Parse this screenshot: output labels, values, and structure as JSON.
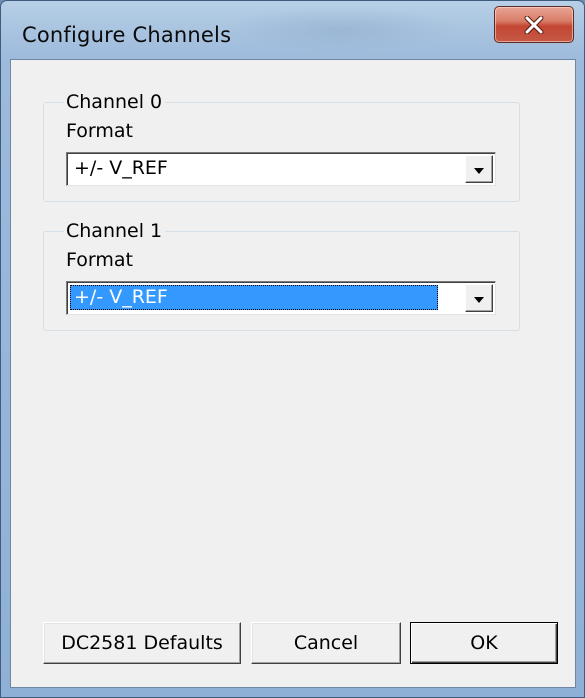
{
  "window": {
    "title": "Configure Channels"
  },
  "channels": [
    {
      "group_label": "Channel 0",
      "format_label": "Format",
      "format_value": "+/- V_REF",
      "selected": false
    },
    {
      "group_label": "Channel 1",
      "format_label": "Format",
      "format_value": "+/- V_REF",
      "selected": true
    }
  ],
  "buttons": {
    "defaults_label": "DC2581 Defaults",
    "cancel_label": "Cancel",
    "ok_label": "OK"
  },
  "icons": {
    "close": "close-icon",
    "dropdown": "chevron-down-icon"
  },
  "colors": {
    "selection": "#3399ff",
    "close_button": "#c34633",
    "dialog_bg": "#f0f0f0"
  }
}
